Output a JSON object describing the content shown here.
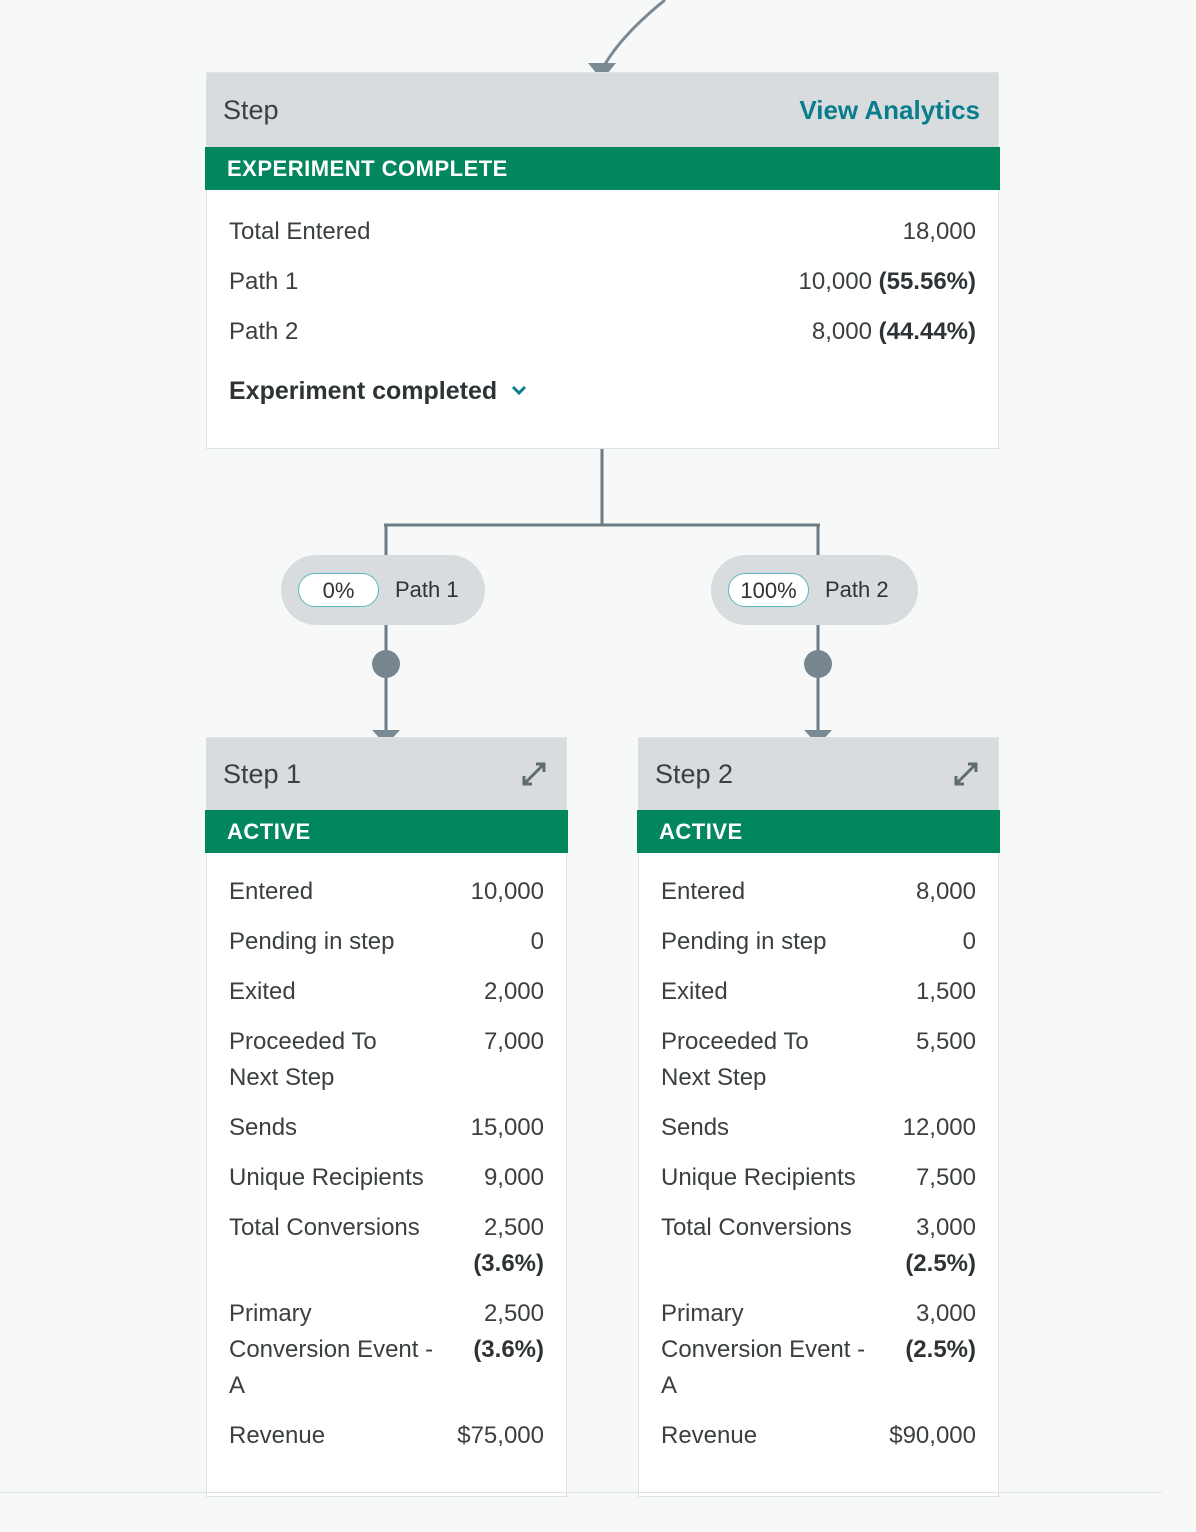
{
  "experiment": {
    "title": "Step",
    "link": "View Analytics",
    "status": "EXPERIMENT COMPLETE",
    "total_label": "Total Entered",
    "total_value": "18,000",
    "path1_label": "Path 1",
    "path1_value": "10,000",
    "path1_pct": "(55.56%)",
    "path2_label": "Path 2",
    "path2_value": "8,000",
    "path2_pct": "(44.44%)",
    "dropdown": "Experiment completed"
  },
  "paths": {
    "p1_pct": "0%",
    "p1_name": "Path 1",
    "p2_pct": "100%",
    "p2_name": "Path 2"
  },
  "step1": {
    "title": "Step 1",
    "status": "ACTIVE",
    "entered_label": "Entered",
    "entered": "10,000",
    "pending_label": "Pending in step",
    "pending": "0",
    "exited_label": "Exited",
    "exited": "2,000",
    "proceeded_label": "Proceeded To Next Step",
    "proceeded": "7,000",
    "sends_label": "Sends",
    "sends": "15,000",
    "unique_label": "Unique Recipients",
    "unique": "9,000",
    "total_conv_label": "Total Conversions",
    "total_conv": "2,500",
    "total_conv_pct": "(3.6%)",
    "primary_label": "Primary Conversion Event - A",
    "primary": "2,500",
    "primary_pct": "(3.6%)",
    "revenue_label": "Revenue",
    "revenue": "$75,000"
  },
  "step2": {
    "title": "Step 2",
    "status": "ACTIVE",
    "entered_label": "Entered",
    "entered": "8,000",
    "pending_label": "Pending in step",
    "pending": "0",
    "exited_label": "Exited",
    "exited": "1,500",
    "proceeded_label": "Proceeded To Next Step",
    "proceeded": "5,500",
    "sends_label": "Sends",
    "sends": "12,000",
    "unique_label": "Unique Recipients",
    "unique": "7,500",
    "total_conv_label": "Total Conversions",
    "total_conv": "3,000",
    "total_conv_pct": "(2.5%)",
    "primary_label": "Primary Conversion Event - A",
    "primary": "3,000",
    "primary_pct": "(2.5%)",
    "revenue_label": "Revenue",
    "revenue": "$90,000"
  },
  "icons": {
    "expand": "expand-icon",
    "chevron": "chevron-down-icon",
    "arrow": "arrow-down-icon"
  },
  "colors": {
    "status_green": "#02865e",
    "link_teal": "#0a7d8c",
    "connector": "#7a8a94"
  }
}
